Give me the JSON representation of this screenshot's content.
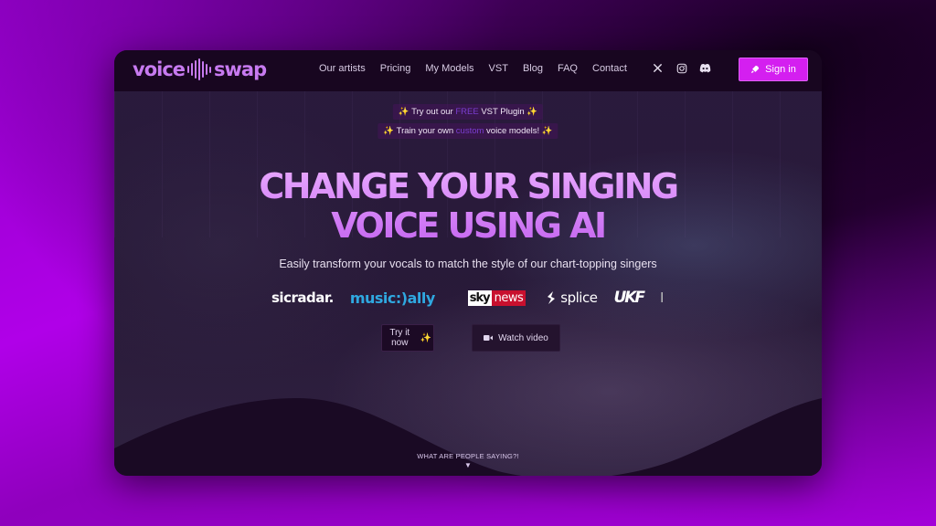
{
  "brand": {
    "name_left": "voice",
    "name_right": "swap",
    "accent_color": "#d41ff0"
  },
  "nav": {
    "links": [
      "Our artists",
      "Pricing",
      "My Models",
      "VST",
      "Blog",
      "FAQ",
      "Contact"
    ],
    "socials": [
      {
        "name": "x-twitter-icon",
        "glyph": "𝕏"
      },
      {
        "name": "instagram-icon",
        "glyph": ""
      },
      {
        "name": "discord-icon",
        "glyph": ""
      }
    ],
    "signin_label": "Sign in"
  },
  "promos": [
    {
      "sparkle": "✨",
      "before": " Try out our ",
      "highlight": "FREE",
      "after": " VST Plugin ",
      "sparkle_end": "✨"
    },
    {
      "sparkle": "✨",
      "before": " Train your own ",
      "highlight": "custom",
      "after": " voice models! ",
      "sparkle_end": "✨"
    }
  ],
  "hero": {
    "headline_line1": "CHANGE YOUR SINGING",
    "headline_line2": "VOICE USING AI",
    "subtitle": "Easily transform your vocals to match the style of our chart-topping singers"
  },
  "press_logos": {
    "musicradar": "sicradar.",
    "musically": "music:)ally",
    "sky": "sky",
    "news": "news",
    "splice": "splice",
    "ukf": "UKF",
    "next": "I"
  },
  "cta": {
    "try_label": "Try it now",
    "try_sparkle": "✨",
    "watch_label": "Watch video"
  },
  "testimonials_prompt": {
    "label": "WHAT ARE PEOPLE SAYING?!",
    "arrow": "▼"
  }
}
